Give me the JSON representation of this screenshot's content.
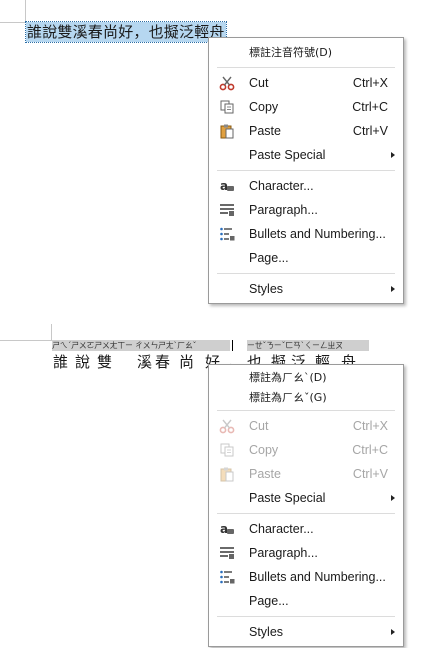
{
  "document": {
    "selected_text": "誰說雙溪春尚好，也擬泛輕舟",
    "ruby_left": "ㄕㄟˊㄕㄨㄛㄕㄨㄤㄒㄧ ㄔㄨㄣㄕㄤˋㄏㄠˇ",
    "ruby_right": "ㄧㄝˇㄋㄧˇㄈㄢˋㄑㄧㄥㄓㄡ",
    "base_chars": [
      "誰",
      "說",
      "雙",
      "溪",
      "春",
      "尚",
      "好",
      "，",
      "也",
      "擬",
      "泛",
      "輕",
      "舟"
    ]
  },
  "menu1": {
    "items": [
      {
        "label": "標註注音符號(D)",
        "icon": ""
      },
      {
        "label": "Cut",
        "shortcut": "Ctrl+X",
        "icon": "scissors-icon"
      },
      {
        "label": "Copy",
        "shortcut": "Ctrl+C",
        "icon": "copy-icon"
      },
      {
        "label": "Paste",
        "shortcut": "Ctrl+V",
        "icon": "clipboard-icon"
      },
      {
        "label": "Paste Special",
        "icon": ""
      },
      {
        "label": "Character...",
        "icon": "character-icon"
      },
      {
        "label": "Paragraph...",
        "icon": "paragraph-icon"
      },
      {
        "label": "Bullets and Numbering...",
        "icon": "bullets-icon"
      },
      {
        "label": "Page...",
        "icon": ""
      },
      {
        "label": "Styles",
        "icon": ""
      }
    ]
  },
  "menu2": {
    "items": [
      {
        "label": "標註為ㄏㄠˋ(D)",
        "icon": ""
      },
      {
        "label": "標註為ㄏㄠˇ(G)",
        "icon": ""
      },
      {
        "label": "Cut",
        "shortcut": "Ctrl+X",
        "icon": "scissors-icon",
        "disabled": true
      },
      {
        "label": "Copy",
        "shortcut": "Ctrl+C",
        "icon": "copy-icon",
        "disabled": true
      },
      {
        "label": "Paste",
        "shortcut": "Ctrl+V",
        "icon": "clipboard-icon",
        "disabled": true
      },
      {
        "label": "Paste Special",
        "icon": ""
      },
      {
        "label": "Character...",
        "icon": "character-icon"
      },
      {
        "label": "Paragraph...",
        "icon": "paragraph-icon"
      },
      {
        "label": "Bullets and Numbering...",
        "icon": "bullets-icon"
      },
      {
        "label": "Page...",
        "icon": ""
      },
      {
        "label": "Styles",
        "icon": ""
      }
    ]
  }
}
